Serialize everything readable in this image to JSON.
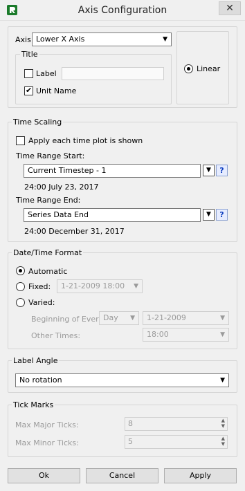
{
  "window": {
    "title": "Axis Configuration",
    "close_glyph": "✕"
  },
  "axis": {
    "label": "Axis",
    "selected": "Lower X Axis",
    "title_group": "Title",
    "label_checkbox": {
      "text": "Label",
      "checked": false,
      "value": ""
    },
    "unit_checkbox": {
      "text": "Unit Name",
      "checked": true
    },
    "scale_radio": {
      "text": "Linear",
      "checked": true
    }
  },
  "time_scaling": {
    "title": "Time Scaling",
    "apply_each": {
      "text": "Apply each time plot is shown",
      "checked": false
    },
    "start": {
      "label": "Time Range Start:",
      "value": "Current Timestep - 1",
      "resolved": "24:00 July 23, 2017"
    },
    "end": {
      "label": "Time Range End:",
      "value": "Series Data End",
      "resolved": "24:00 December 31, 2017"
    },
    "help_glyph": "?",
    "dropdown_glyph": "▼"
  },
  "datetime_format": {
    "title": "Date/Time Format",
    "automatic": {
      "text": "Automatic",
      "checked": true
    },
    "fixed": {
      "text": "Fixed:",
      "checked": false,
      "value": "1-21-2009 18:00"
    },
    "varied": {
      "text": "Varied:",
      "checked": false,
      "beginning_label": "Beginning of Every:",
      "period": "Day",
      "beginning_value": "1-21-2009",
      "other_label": "Other Times:",
      "other_value": "18:00"
    }
  },
  "label_angle": {
    "title": "Label Angle",
    "value": "No rotation"
  },
  "tick_marks": {
    "title": "Tick Marks",
    "major_label": "Max Major Ticks:",
    "major_value": "8",
    "minor_label": "Max Minor Ticks:",
    "minor_value": "5"
  },
  "buttons": {
    "ok": "Ok",
    "cancel": "Cancel",
    "apply": "Apply"
  },
  "icons": {
    "app": "rivware-r-icon",
    "close": "close-icon",
    "dropdown": "chevron-down-icon",
    "help": "help-icon"
  }
}
